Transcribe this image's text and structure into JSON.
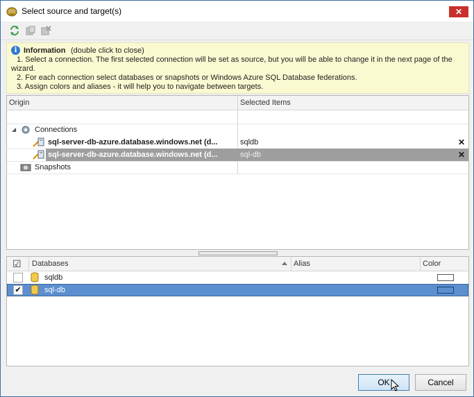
{
  "window": {
    "title": "Select source and target(s)",
    "close_glyph": "✕"
  },
  "toolbar": {
    "icons": [
      "refresh-icon",
      "copy-icon",
      "delete-icon"
    ]
  },
  "info": {
    "title": "Information",
    "hint": "(double click to close)",
    "lines": [
      "1. Select a connection. The first selected connection will be set as source, but you will be able to change it in the next page of the",
      "wizard.",
      "2. For each connection select databases or snapshots or Windows Azure SQL Database federations.",
      "3. Assign colors and aliases - it will help you to navigate between targets."
    ]
  },
  "tree": {
    "col_origin": "Origin",
    "col_selected": "Selected Items",
    "connections_label": "Connections",
    "connections": [
      {
        "name": "sql-server-db-azure.database.windows.net (d...",
        "selected_items": "sqldb",
        "remove": "✕"
      },
      {
        "name": "sql-server-db-azure.database.windows.net (d...",
        "selected_items": "sql-db",
        "remove": "✕"
      }
    ],
    "snapshots_label": "Snapshots"
  },
  "databases": {
    "col_databases": "Databases",
    "col_alias": "Alias",
    "col_color": "Color",
    "rows": [
      {
        "name": "sqldb",
        "checked": false,
        "alias": ""
      },
      {
        "name": "sql-db",
        "checked": true,
        "alias": ""
      }
    ],
    "check_glyph": "✔",
    "header_check_glyph": "☑"
  },
  "buttons": {
    "ok": "OK",
    "cancel": "Cancel"
  },
  "colors": {
    "selected_row_gray": "#9e9e9e",
    "selected_row_blue": "#5b8fcf",
    "info_bg": "#fafad2"
  }
}
